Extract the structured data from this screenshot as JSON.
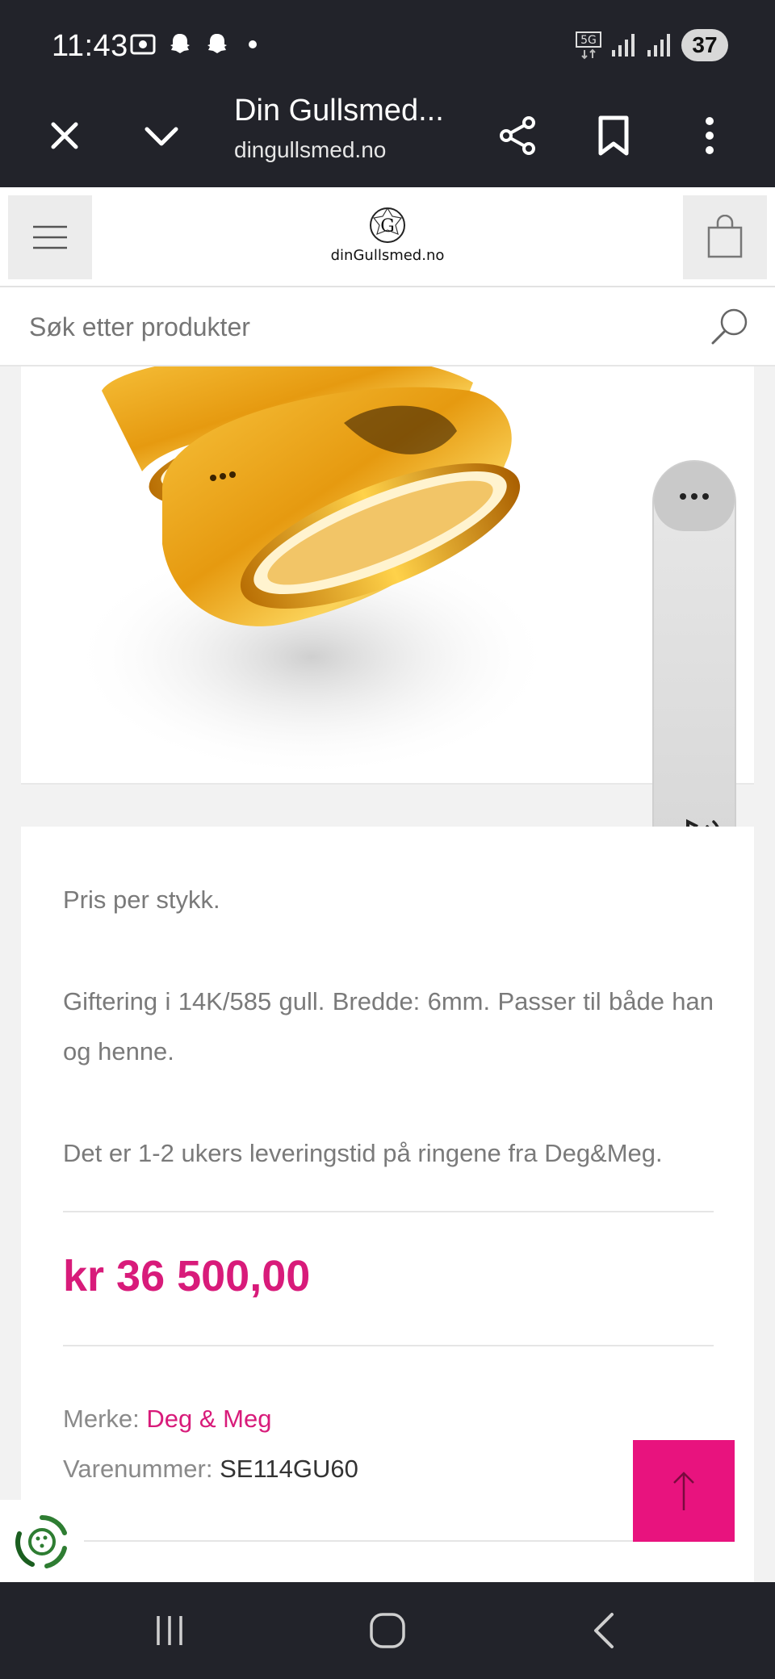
{
  "status_bar": {
    "time": "11:43",
    "battery": "37",
    "network": "5G"
  },
  "browser": {
    "title": "Din Gullsmed...",
    "url": "dingullsmed.no",
    "close_icon": "close-icon",
    "tabs_icon": "chevron-down-icon",
    "share_icon": "share-icon",
    "bookmark_icon": "bookmark-icon",
    "more_icon": "more-vertical-icon"
  },
  "site": {
    "logo_text": "dinGullsmed.no",
    "logo_monogram": "G"
  },
  "search": {
    "placeholder": "Søk etter produkter"
  },
  "product": {
    "description_1": "Pris per stykk.",
    "description_2": "Giftering i 14K/585 gull. Bredde: 6mm. Passer til både han og henne.",
    "description_3": "Det er 1-2 ukers leveringstid på ringene fra Deg&Meg.",
    "price": "kr 36 500,00",
    "brand_label": "Merke:",
    "brand_value": "Deg & Meg",
    "sku_label": "Varenummer:",
    "sku_value": "SE114GU60"
  },
  "colors": {
    "accent": "#d81b7a",
    "scroll_top": "#e8137e",
    "system_bar": "#22232a"
  }
}
